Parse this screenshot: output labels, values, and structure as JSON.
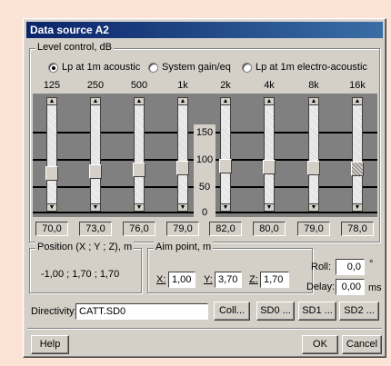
{
  "dialog": {
    "title": "Data source A2"
  },
  "level_control": {
    "group_label": "Level control, dB",
    "radios": [
      {
        "label": "Lp at 1m acoustic",
        "selected": true
      },
      {
        "label": "System gain/eq",
        "selected": false
      },
      {
        "label": "Lp at 1m electro-acoustic",
        "selected": false
      }
    ],
    "frequencies": [
      "125",
      "250",
      "500",
      "1k",
      "2k",
      "4k",
      "8k",
      "16k"
    ],
    "scale_labels": [
      "150",
      "100",
      "50",
      "0"
    ],
    "values": [
      "70,0",
      "73,0",
      "76,0",
      "79,0",
      "82,0",
      "80,0",
      "79,0",
      "78,0"
    ]
  },
  "position": {
    "group_label": "Position (X ; Y ; Z), m",
    "value": "-1,00 ; 1,70 ; 1,70"
  },
  "aim_point": {
    "group_label": "Aim point, m",
    "x_label": "X:",
    "x_value": "1,00",
    "y_label": "Y:",
    "y_value": "3,70",
    "z_label": "Z:",
    "z_value": "1,70"
  },
  "roll": {
    "label": "Roll:",
    "value": "0,0",
    "unit": "°"
  },
  "delay": {
    "label": "Delay:",
    "value": "0,00",
    "unit": "ms"
  },
  "directivity": {
    "label": "Directivity:",
    "value": "CATT.SD0",
    "buttons": {
      "coll": "Coll...",
      "sd0": "SD0 ...",
      "sd1": "SD1 ...",
      "sd2": "SD2 ..."
    }
  },
  "footer": {
    "help": "Help",
    "ok": "OK",
    "cancel": "Cancel"
  }
}
